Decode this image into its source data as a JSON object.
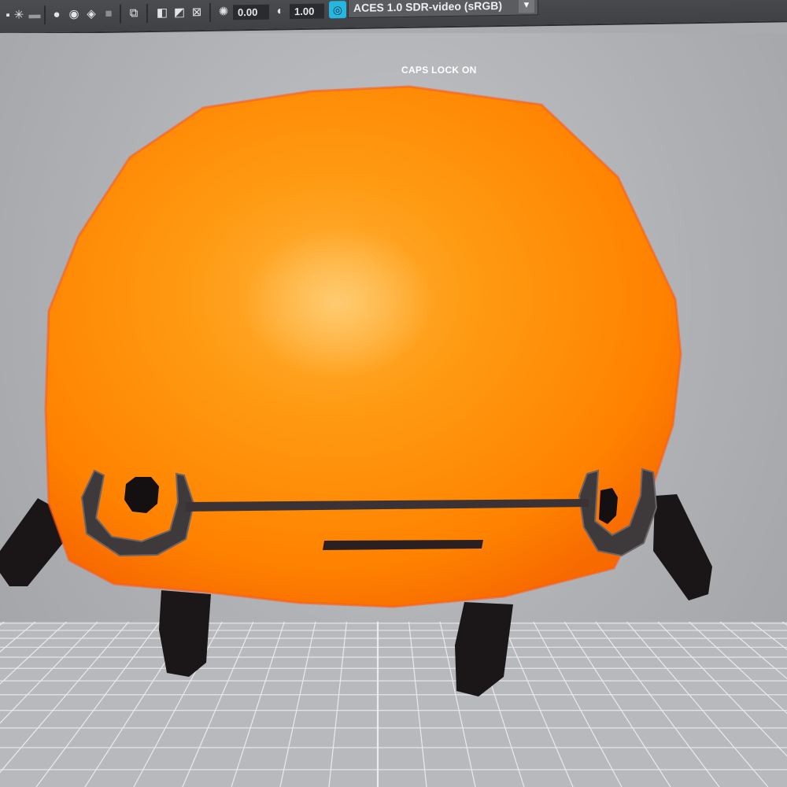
{
  "toolbar": {
    "exposure_value": "0.00",
    "gamma_value": "1.00",
    "color_management_label": "ACES 1.0 SDR-video (sRGB)",
    "icons": [
      "grid-icon",
      "light-icon",
      "shadow-icon",
      "sphere-icon",
      "texture-icon",
      "wireframe-icon",
      "isolate-icon",
      "camera-icon",
      "xray-icon",
      "backface-icon",
      "frame-icon",
      "exposure-icon",
      "gamma-icon",
      "color-management-icon",
      "chevron-down-icon"
    ]
  },
  "viewport": {
    "status_text": "CAPS LOCK ON",
    "body_color": "#ff8a00",
    "leg_color": "#1a1618",
    "grid_color": "#e9eaec"
  }
}
